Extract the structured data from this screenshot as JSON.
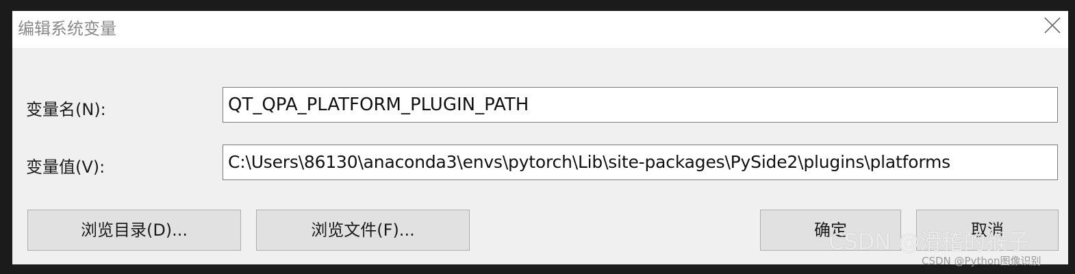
{
  "dialog": {
    "title": "编辑系统变量",
    "close_icon": "close-icon"
  },
  "form": {
    "name_label": "变量名(N):",
    "name_value": "QT_QPA_PLATFORM_PLUGIN_PATH",
    "value_label": "变量值(V):",
    "value_value": "C:\\Users\\86130\\anaconda3\\envs\\pytorch\\Lib\\site-packages\\PySide2\\plugins\\platforms"
  },
  "buttons": {
    "browse_dir": "浏览目录(D)...",
    "browse_file": "浏览文件(F)...",
    "ok": "确定",
    "cancel": "取消"
  },
  "watermarks": {
    "overlay": "CSDN @滑稽的猴子",
    "footer": "CSDN @Python图像识别"
  },
  "colors": {
    "dialog_bg": "#f0f0f0",
    "titlebar_bg": "#ffffff",
    "button_bg": "#e1e1e1",
    "outer_bg": "#1b1b1b"
  }
}
